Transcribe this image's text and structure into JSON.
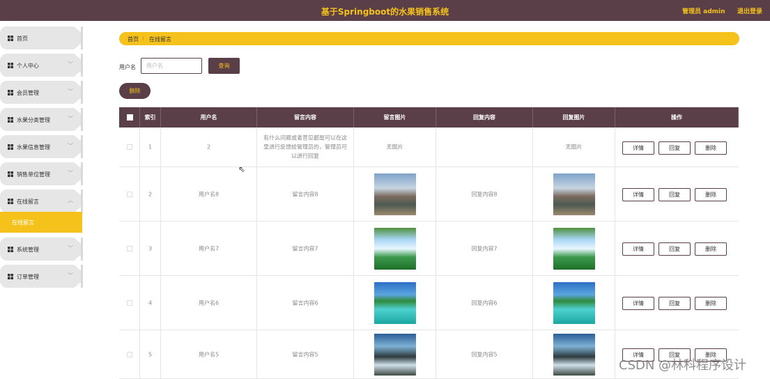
{
  "app": {
    "title": "基于Springboot的水果销售系统",
    "admin_label": "管理员 admin",
    "logout_label": "退出登录"
  },
  "colors": {
    "primary": "#5a3f49",
    "accent": "#f5c21b"
  },
  "sidebar": {
    "items": [
      {
        "label": "首页",
        "icon": "home-icon"
      },
      {
        "label": "个人中心",
        "icon": "user-icon"
      },
      {
        "label": "会员管理",
        "icon": "member-icon"
      },
      {
        "label": "水果分类管理",
        "icon": "sliders-icon"
      },
      {
        "label": "水果信息管理",
        "icon": "document-icon"
      },
      {
        "label": "销售单位管理",
        "icon": "grid-icon"
      },
      {
        "label": "在线留言",
        "icon": "grid-icon"
      },
      {
        "label": "系统管理",
        "icon": "user-icon"
      },
      {
        "label": "订单管理",
        "icon": "grid-icon"
      }
    ],
    "active_sub": "在线留言"
  },
  "breadcrumb": {
    "home": "首页",
    "separator": "⁝",
    "current": "在线留言"
  },
  "search": {
    "label": "用户名",
    "placeholder": "用户名",
    "value": "",
    "button": "查询"
  },
  "actions": {
    "delete": "删除"
  },
  "table": {
    "headers": [
      "索引",
      "用户名",
      "留言内容",
      "留言图片",
      "回复内容",
      "回复图片",
      "操作"
    ],
    "rows": [
      {
        "index": "1",
        "username": "2",
        "content": "有什么问题或者意见都是可以在这里进行反馈给管理员的，管理员可以进行回复",
        "image": "无图片",
        "reply": "",
        "reply_image": "无图片"
      },
      {
        "index": "2",
        "username": "用户名8",
        "content": "留言内容8",
        "image": "img-arch",
        "reply": "回复内容8",
        "reply_image": "img-arch"
      },
      {
        "index": "3",
        "username": "用户名7",
        "content": "留言内容7",
        "image": "img-falls",
        "reply": "回复内容7",
        "reply_image": "img-falls"
      },
      {
        "index": "4",
        "username": "用户名6",
        "content": "留言内容6",
        "image": "img-pier",
        "reply": "回复内容6",
        "reply_image": "img-pier"
      },
      {
        "index": "5",
        "username": "用户名5",
        "content": "留言内容5",
        "image": "img-cliff",
        "reply": "回复内容5",
        "reply_image": "img-cliff"
      }
    ],
    "row_actions": [
      "详情",
      "回复",
      "删除"
    ]
  },
  "watermark": "CSDN @林科程序设计"
}
